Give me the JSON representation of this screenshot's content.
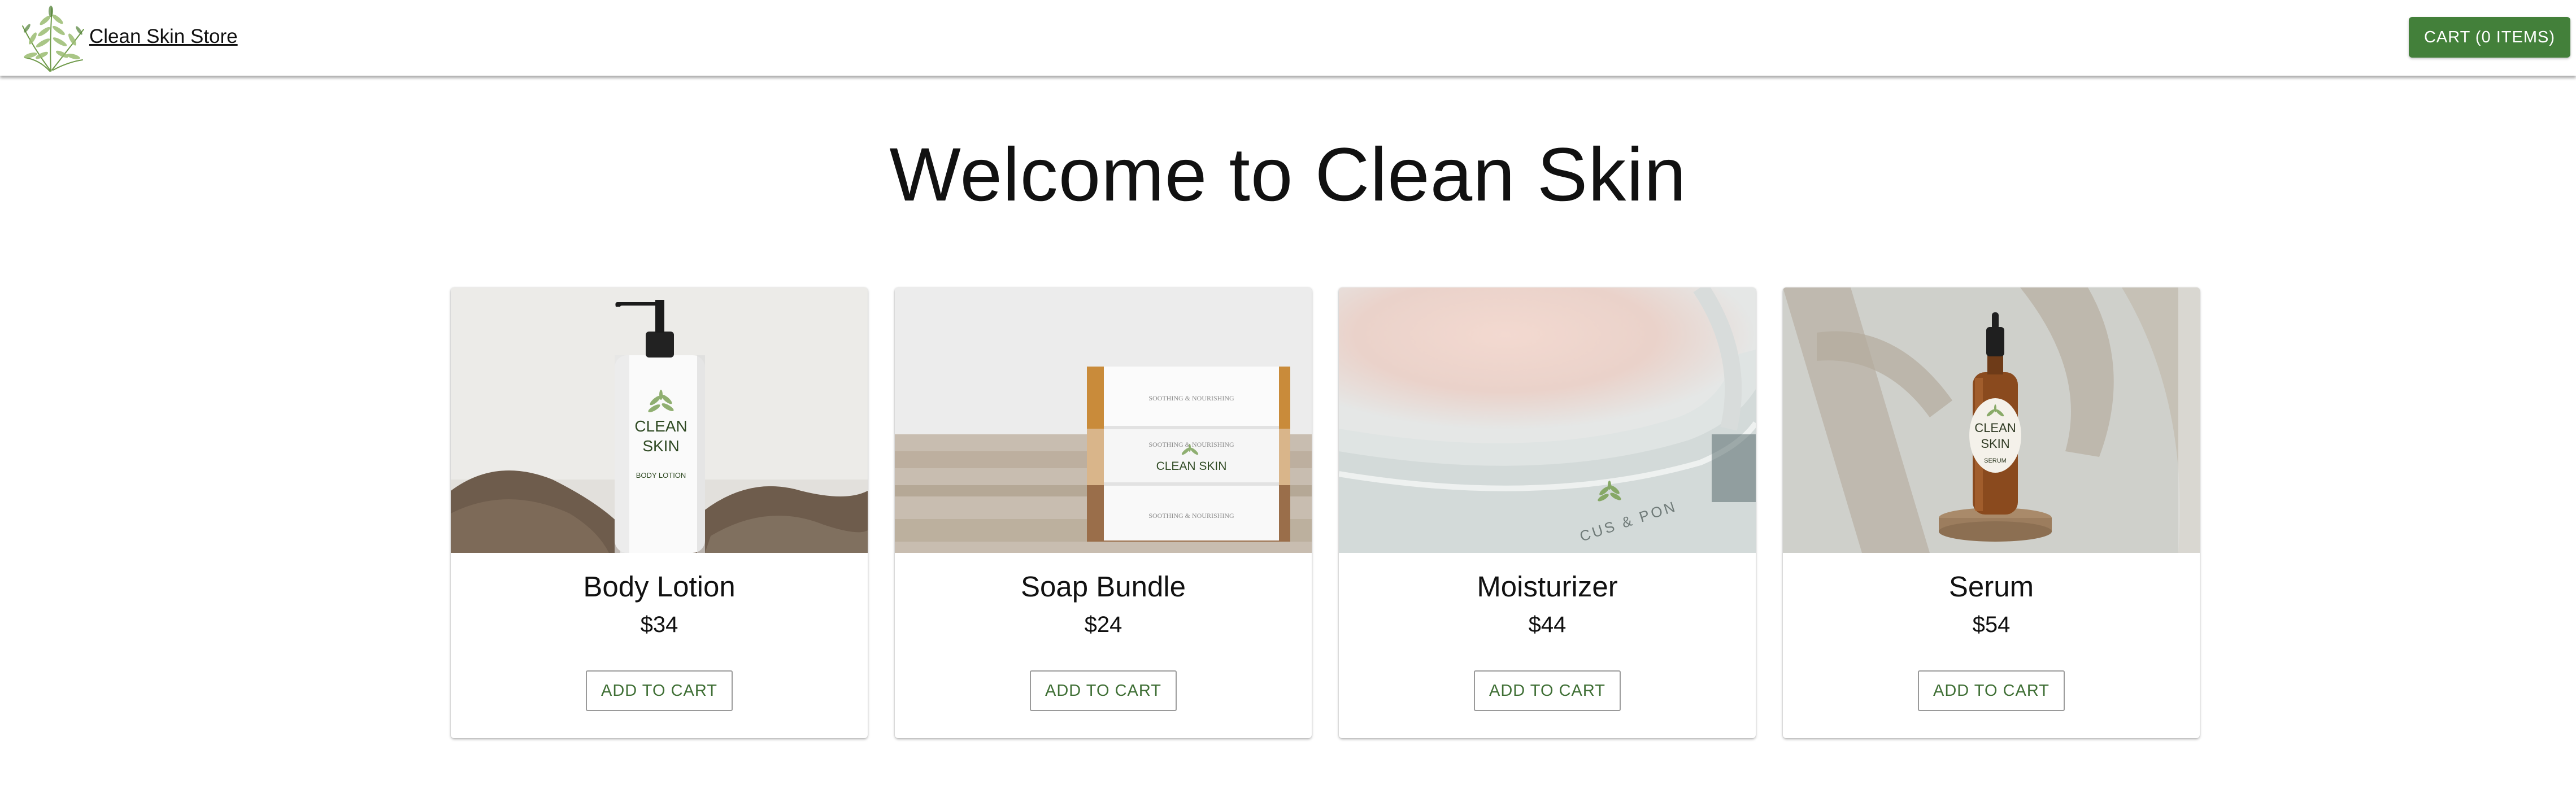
{
  "header": {
    "store_name": "Clean Skin Store",
    "cart_label": "CART (0 ITEMS)",
    "logo_icon": "fern-leaf-logo",
    "accent_color": "#43803a"
  },
  "main": {
    "welcome_title": "Welcome to Clean Skin"
  },
  "products": [
    {
      "name": "Body Lotion",
      "price": "$34",
      "button_label": "ADD TO CART",
      "image": "body-lotion-bottle-photo",
      "label_lines": [
        "CLEAN",
        "SKIN",
        "BODY LOTION"
      ]
    },
    {
      "name": "Soap Bundle",
      "price": "$24",
      "button_label": "ADD TO CART",
      "image": "soap-bundle-stack-photo",
      "label_lines": [
        "CLEAN SKIN"
      ]
    },
    {
      "name": "Moisturizer",
      "price": "$44",
      "button_label": "ADD TO CART",
      "image": "moisturizer-jar-closeup-photo",
      "label_lines": []
    },
    {
      "name": "Serum",
      "price": "$54",
      "button_label": "ADD TO CART",
      "image": "serum-dropper-bottle-photo",
      "label_lines": [
        "CLEAN",
        "SKIN",
        "SERUM"
      ]
    }
  ]
}
